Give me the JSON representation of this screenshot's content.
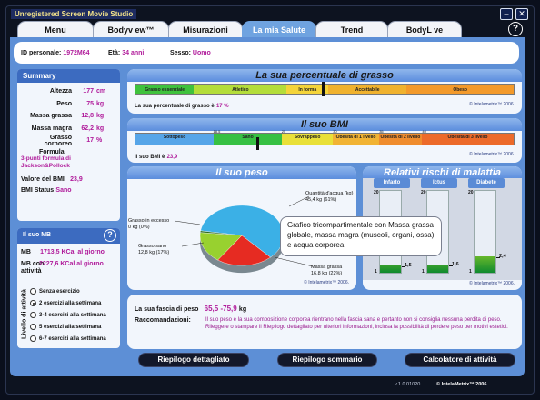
{
  "window": {
    "title": "Unregistered Screen Movie Studio"
  },
  "tabs": [
    {
      "label": "Menu"
    },
    {
      "label": "Bodyv ew™"
    },
    {
      "label": "Misurazioni"
    },
    {
      "label": "La mia Salute"
    },
    {
      "label": "Trend"
    },
    {
      "label": "BodyL ve"
    }
  ],
  "header": {
    "id_label": "ID personale:",
    "id_value": "1972M64",
    "age_label": "Età:",
    "age_value": "34",
    "age_unit": "anni",
    "sex_label": "Sesso:",
    "sex_value": "Uomo"
  },
  "summary": {
    "title": "Summary",
    "rows": [
      {
        "label": "Altezza",
        "value": "177",
        "unit": "cm"
      },
      {
        "label": "Peso",
        "value": "75",
        "unit": "kg"
      },
      {
        "label": "Massa grassa",
        "value": "12,8",
        "unit": "kg"
      },
      {
        "label": "Massa magra",
        "value": "62,2",
        "unit": "kg"
      },
      {
        "label": "Grasso corporeo",
        "value": "17",
        "unit": "%"
      }
    ],
    "formula_label": "Formula",
    "formula_value": "3-punti formula di Jackson&Pollock",
    "bmi_label": "Valore del BMI",
    "bmi_value": "23,9",
    "bmi_status_label": "BMI Status",
    "bmi_status_value": "Sano"
  },
  "mb": {
    "title": "Il suo MB",
    "line1_label": "MB",
    "line1_value": "1713,5 KCal al giorno",
    "line2_label": "MB con attività",
    "line2_value": "2227,6 KCal al giorno",
    "activity_label": "Livello di attività",
    "options": [
      "Senza esercizio",
      "2 esercizi alla settimana",
      "3-4 esercizi alla settimana",
      "5 esercizi alla settimana",
      "6-7 esercizi alla settimana"
    ],
    "selected": 1
  },
  "fat": {
    "title": "La sua percentuale di grasso",
    "segments": [
      {
        "label": "Grasso essenziale",
        "color": "#3fc23d"
      },
      {
        "label": "Atletico",
        "color": "#b4dd3a"
      },
      {
        "label": "In forma",
        "color": "#f4d43a"
      },
      {
        "label": "Accettabile",
        "color": "#f0b22e"
      },
      {
        "label": "Obeso",
        "color": "#f39a2b"
      }
    ],
    "result_label": "La sua percentuale di grasso è",
    "result_value": "17 %",
    "copyright": "© Intelametrix™ 2006."
  },
  "bmi": {
    "title": "Il suo BMI",
    "segments": [
      {
        "label": "Sottopeso",
        "color": "#56a5e8"
      },
      {
        "label": "Sano",
        "color": "#37c043"
      },
      {
        "label": "Sovrappeso",
        "color": "#e9e039"
      },
      {
        "label": "Obesità di 1 livello",
        "color": "#f1b334"
      },
      {
        "label": "Obesità di 2 livello",
        "color": "#ef8c2e"
      },
      {
        "label": "Obesità di 3 livello",
        "color": "#ec6a2a"
      }
    ],
    "ticks": [
      "18.5",
      "25",
      "30",
      "35",
      "40"
    ],
    "result_label": "Il suo BMI è",
    "result_value": "23,9",
    "copyright": "© Intelametrix™ 2006."
  },
  "weight": {
    "title": "Il suo peso",
    "slices": [
      {
        "label": "Quantità d'acqua (kg)",
        "value": "45,4 kg (61%)",
        "color": "#3bb0e6"
      },
      {
        "label": "Massa grassa",
        "value": "16,8 kg (22%)",
        "color": "#e62b22"
      },
      {
        "label": "Grasso sano",
        "value": "12,8 kg (17%)",
        "color": "#98d12f"
      },
      {
        "label": "Grasso in eccesso",
        "value": "0 kg (0%)",
        "color": "#2a6a1e"
      }
    ],
    "tooltip": "Grafico tricompartimentale con Massa grassa globale, massa magra (muscoli, organi, ossa) e acqua corporea.",
    "copyright": "© Intelametrix™ 2006."
  },
  "risks": {
    "title": "Relativi rischi di malattia",
    "gauges": [
      {
        "name": "Infarto",
        "level": 0.09,
        "top": "20",
        "bottom": "1",
        "marker": "1,5"
      },
      {
        "name": "Ictus",
        "level": 0.1,
        "top": "20",
        "bottom": "1",
        "marker": "1,6"
      },
      {
        "name": "Diabete",
        "level": 0.2,
        "top": "20",
        "bottom": "1",
        "marker": "2,4"
      }
    ],
    "copyright": "© Intelametrix™ 2006."
  },
  "range": {
    "label": "La sua fascia di peso",
    "value": "65,5 -75,9",
    "unit": "kg",
    "rec_label": "Raccomandazioni:",
    "rec_text": "Il suo peso e la sua composizione corporea rientrano nella fascia sana e pertanto non si consiglia nessuna perdita di peso. Rileggere o stampare il Riepilogo dettagliato per ulteriori informazioni, inclusa la possibilità di perdere peso per motivi estetici."
  },
  "buttons": {
    "detail": "Riepilogo dettagliato",
    "summary": "Riepilogo sommario",
    "calc": "Calcolatore di attività"
  },
  "footer": {
    "version": "v.1.0.01020",
    "brand": "© IntelaMetrix™ 2006."
  }
}
